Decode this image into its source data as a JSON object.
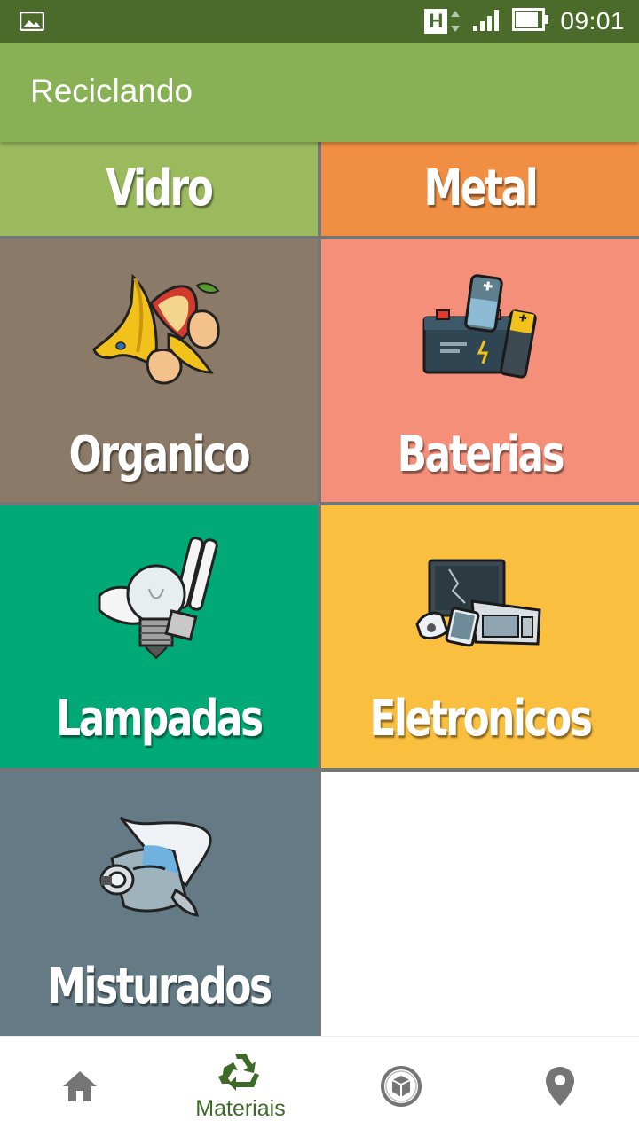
{
  "status_bar": {
    "network": "H",
    "time": "09:01"
  },
  "app_bar": {
    "title": "Reciclando"
  },
  "tiles": [
    {
      "label": "Vidro",
      "color": "#9bba5e",
      "icon": "none"
    },
    {
      "label": "Metal",
      "color": "#f08f44",
      "icon": "none"
    },
    {
      "label": "Organico",
      "color": "#8b7a68",
      "icon": "banana-peel-icon"
    },
    {
      "label": "Baterias",
      "color": "#f48f7a",
      "icon": "battery-icon"
    },
    {
      "label": "Lampadas",
      "color": "#00a975",
      "icon": "light-bulb-icon"
    },
    {
      "label": "Eletronicos",
      "color": "#fbbf40",
      "icon": "electronics-icon"
    },
    {
      "label": "Misturados",
      "color": "#647b85",
      "icon": "mixed-waste-icon"
    }
  ],
  "bottom_nav": {
    "items": [
      {
        "icon": "home-icon",
        "label": ""
      },
      {
        "icon": "recycle-icon",
        "label": "Materiais",
        "active": true
      },
      {
        "icon": "box-icon",
        "label": ""
      },
      {
        "icon": "location-pin-icon",
        "label": ""
      }
    ]
  },
  "colors": {
    "status_bar": "#4a6b2a",
    "app_bar": "#87b154",
    "nav_active": "#3d6a28",
    "nav_inactive": "#757575"
  }
}
